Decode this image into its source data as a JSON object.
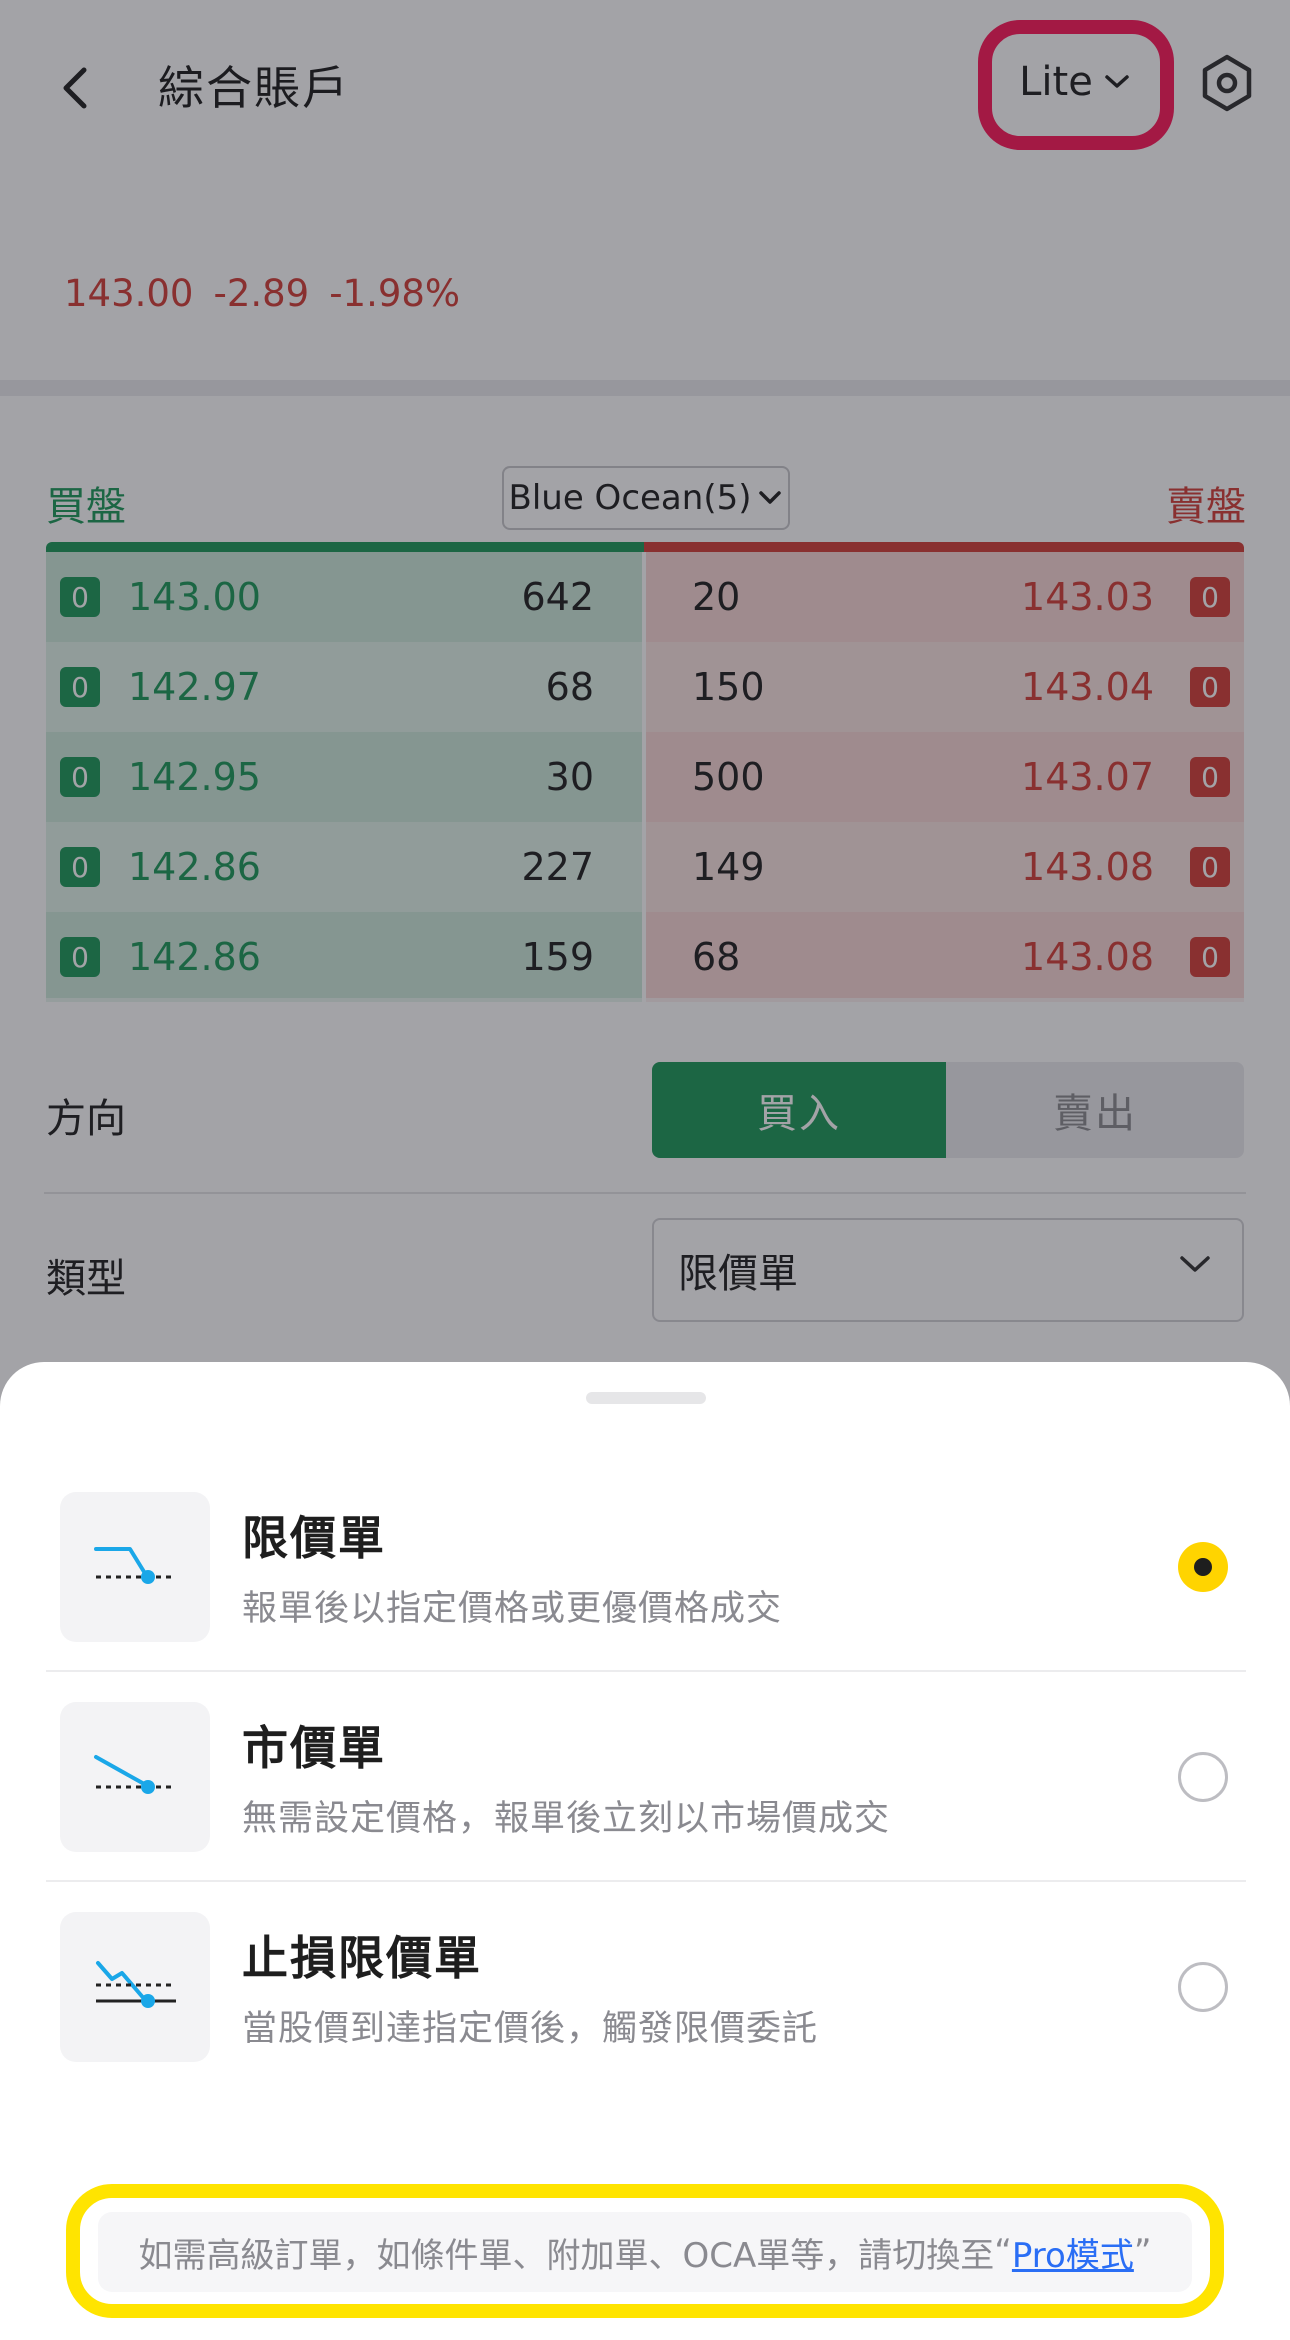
{
  "header": {
    "title": "綜合賬戶",
    "mode_label": "Lite",
    "back_icon": "chevron-left-icon",
    "settings_icon": "gear-icon",
    "highlight_color": "#ff1a5a"
  },
  "quote": {
    "price": "143.00",
    "change": "-2.89",
    "change_pct": "-1.98%",
    "color": "#d4403a"
  },
  "order_book": {
    "bid_title": "買盤",
    "ask_title": "賣盤",
    "depth_label": "Blue Ocean(5)",
    "bid_color": "#1f9a5b",
    "ask_color": "#d4403a",
    "bids": [
      {
        "badge": "0",
        "price": "143.00",
        "qty": "642"
      },
      {
        "badge": "0",
        "price": "142.97",
        "qty": "68"
      },
      {
        "badge": "0",
        "price": "142.95",
        "qty": "30"
      },
      {
        "badge": "0",
        "price": "142.86",
        "qty": "227"
      },
      {
        "badge": "0",
        "price": "142.86",
        "qty": "159"
      }
    ],
    "asks": [
      {
        "badge": "0",
        "price": "143.03",
        "qty": "20"
      },
      {
        "badge": "0",
        "price": "143.04",
        "qty": "150"
      },
      {
        "badge": "0",
        "price": "143.07",
        "qty": "500"
      },
      {
        "badge": "0",
        "price": "143.08",
        "qty": "149"
      },
      {
        "badge": "0",
        "price": "143.08",
        "qty": "68"
      }
    ]
  },
  "form": {
    "direction_label": "方向",
    "buy_label": "買入",
    "sell_label": "賣出",
    "type_label": "類型",
    "type_value": "限價單"
  },
  "sheet": {
    "options": [
      {
        "title": "限價單",
        "desc": "報單後以指定價格或更優價格成交",
        "icon": "limit-order-icon",
        "selected": true
      },
      {
        "title": "市價單",
        "desc": "無需設定價格，報單後立刻以市場價成交",
        "icon": "market-order-icon",
        "selected": false
      },
      {
        "title": "止損限價單",
        "desc": "當股價到達指定價後，觸發限價委託",
        "icon": "stop-limit-order-icon",
        "selected": false
      }
    ],
    "notice_text": "如需高級訂單，如條件單、附加單、OCA單等，請切換至",
    "notice_quote_open": "“",
    "notice_link": "Pro模式",
    "notice_quote_close": "”",
    "selected_color": "#ffd400",
    "notice_highlight_color": "#ffe400",
    "icon_color": "#1aa7e8"
  }
}
